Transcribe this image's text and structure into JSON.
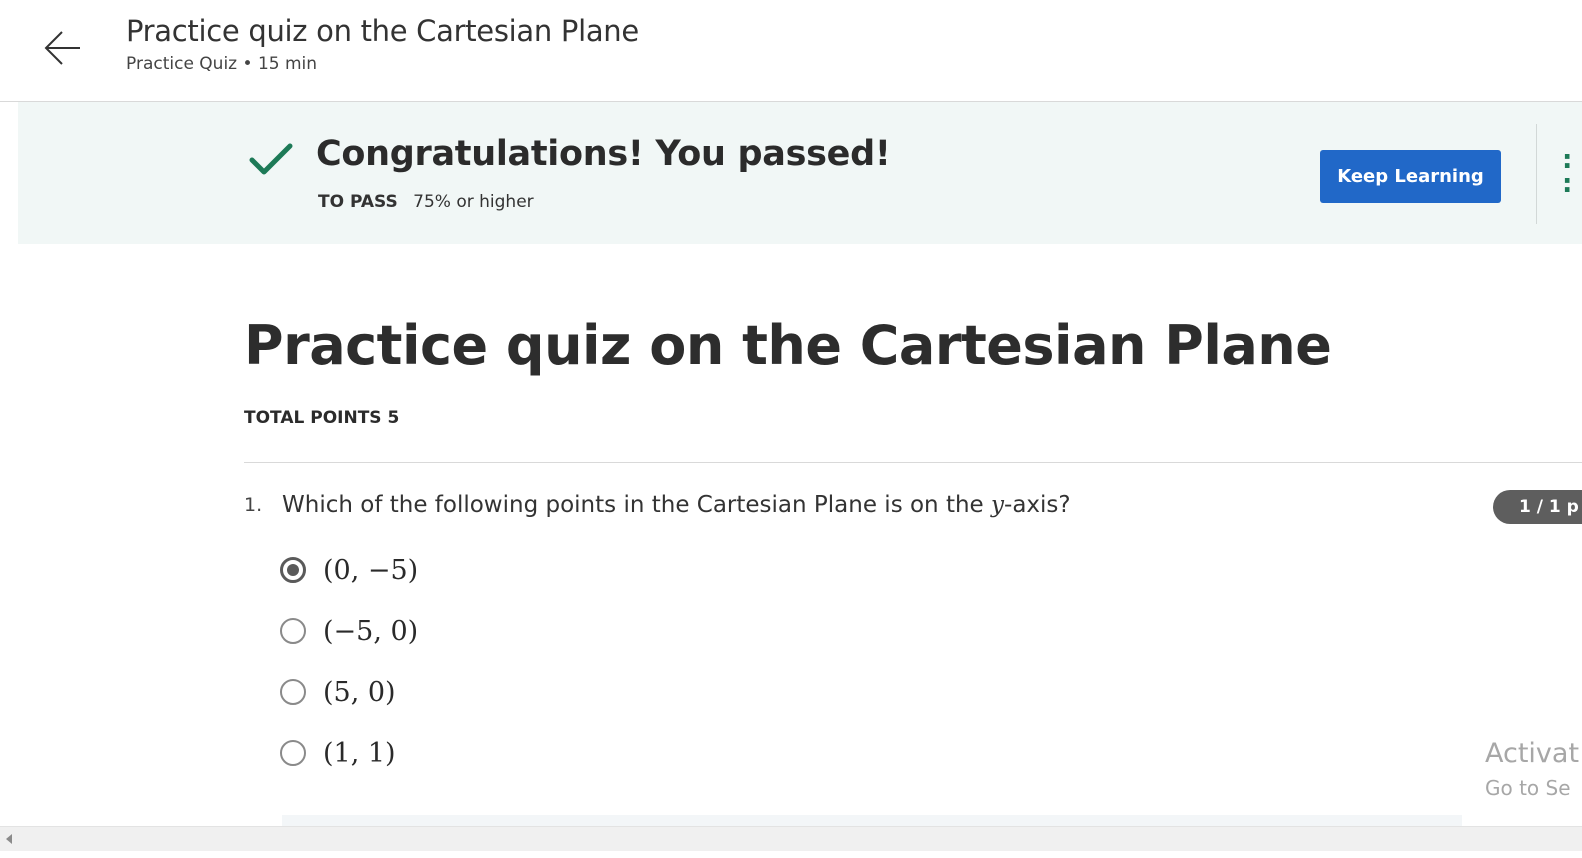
{
  "header": {
    "back_icon": "arrow-left-icon",
    "title": "Practice quiz on the Cartesian Plane",
    "subtitle": "Practice Quiz • 15 min"
  },
  "banner": {
    "icon": "checkmark-icon",
    "message": "Congratulations! You passed!",
    "to_pass_label": "TO PASS",
    "to_pass_value": "75% or higher",
    "keep_learning_label": "Keep Learning",
    "accent_color": "#1d7a57",
    "button_color": "#2168c8"
  },
  "quiz": {
    "title": "Practice quiz on the Cartesian Plane",
    "total_points": "TOTAL POINTS 5"
  },
  "question": {
    "number": "1.",
    "text_before": "Which of the following points in the Cartesian Plane is on the ",
    "text_math": "y",
    "text_after": "-axis?",
    "points": "1 / 1 p",
    "options": [
      {
        "label": "(0, −5)",
        "selected": true
      },
      {
        "label": "(−5, 0)",
        "selected": false
      },
      {
        "label": "(5, 0)",
        "selected": false
      },
      {
        "label": "(1, 1)",
        "selected": false
      }
    ]
  },
  "watermark": {
    "line1": "Activat",
    "line2": "Go to Se"
  }
}
